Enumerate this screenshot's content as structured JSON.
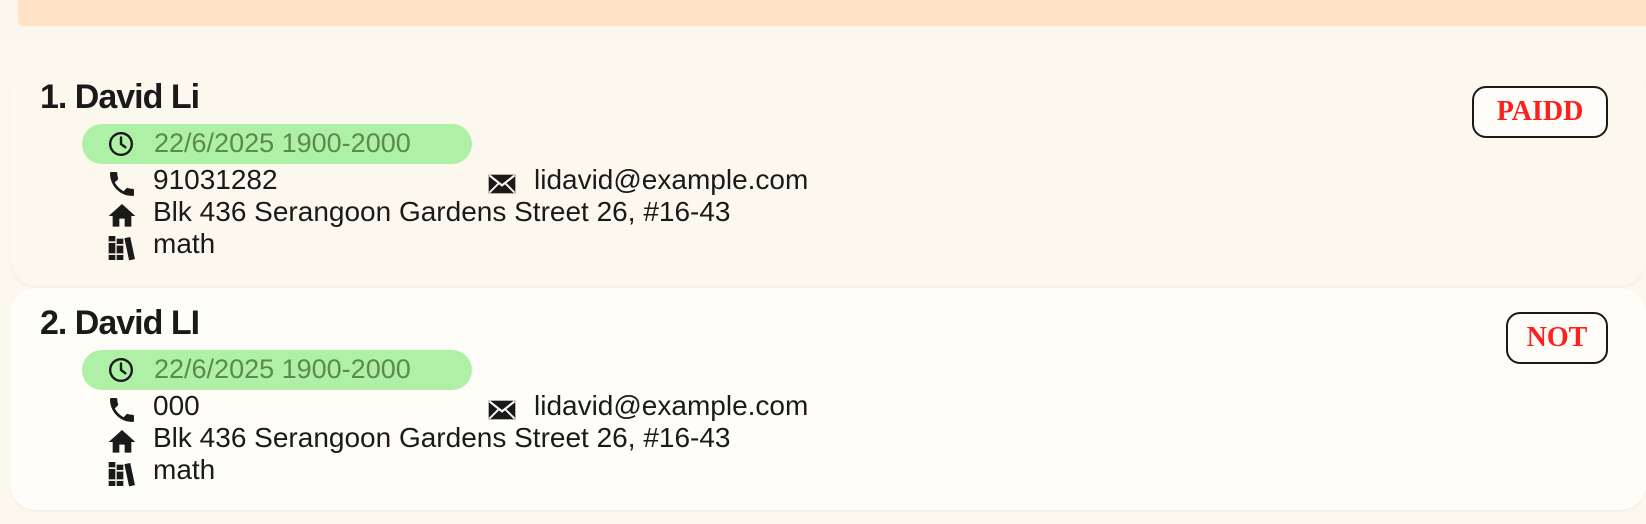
{
  "students": [
    {
      "name": "1. David Li",
      "session": "22/6/2025 1900-2000",
      "phone": "91031282",
      "email": "lidavid@example.com",
      "address": "Blk 436 Serangoon Gardens Street 26, #16-43",
      "subject": "math",
      "payment": "PAIDD"
    },
    {
      "name": "2. David LI",
      "session": "22/6/2025 1900-2000",
      "phone": "000",
      "email": "lidavid@example.com",
      "address": "Blk 436 Serangoon Gardens Street 26, #16-43",
      "subject": "math",
      "payment": "NOT"
    }
  ],
  "colors": {
    "session_bg": "#aef0a5",
    "session_text": "#5b8a4d",
    "payment_text": "#ff1f1f",
    "header_band": "#ffe3c4"
  },
  "icons": [
    "clock-icon",
    "phone-icon",
    "email-icon",
    "home-icon",
    "books-icon"
  ]
}
